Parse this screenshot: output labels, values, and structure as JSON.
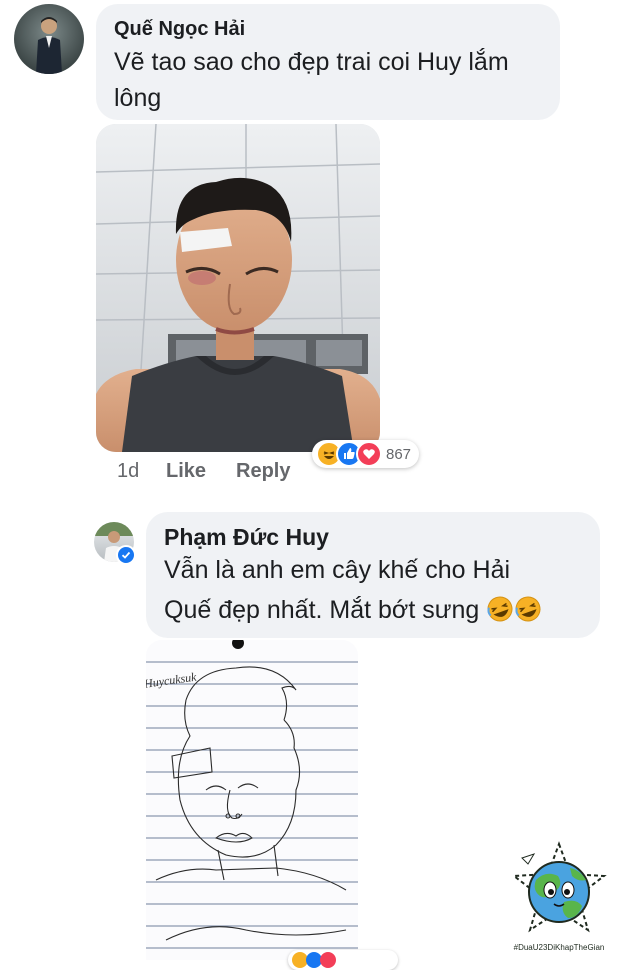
{
  "comment1": {
    "author": "Quế Ngọc Hải",
    "text_line1": "Vẽ tao sao cho đẹp trai coi Huy lắm",
    "text_line2": "lông",
    "reaction_count": "867",
    "time": "1d",
    "like_label": "Like",
    "reply_label": "Reply"
  },
  "reply1": {
    "author": "Phạm Đức Huy",
    "text_line1": "Vẫn là anh em cây khế cho Hải",
    "text_line2": "Quế đẹp nhất. Mắt bớt sưng",
    "emoji": "🤣🤣",
    "sketch_signature": "Huycuksuk"
  },
  "watermark": {
    "hashtag": "#DuaU23DiKhapTheGian"
  },
  "colors": {
    "bubble": "#f0f2f5",
    "meta_text": "#65676b",
    "verified": "#1877f2",
    "haha": "#f7b125",
    "like": "#1877f2",
    "love": "#f33e58"
  }
}
